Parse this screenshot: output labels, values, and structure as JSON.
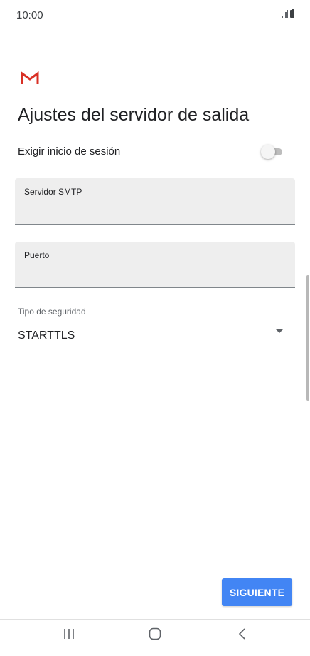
{
  "status_bar": {
    "time": "10:00",
    "signal_icon": "signal-icon",
    "battery_icon": "battery-icon"
  },
  "app": {
    "logo_icon": "gmail-logo-icon",
    "brand_color": "#d93025"
  },
  "page": {
    "title": "Ajustes del servidor de salida"
  },
  "require_signin": {
    "label": "Exigir inicio de sesión",
    "enabled": false
  },
  "fields": {
    "smtp_server": {
      "label": "Servidor SMTP",
      "value": ""
    },
    "port": {
      "label": "Puerto",
      "value": ""
    }
  },
  "security": {
    "label": "Tipo de seguridad",
    "selected": "STARTTLS"
  },
  "actions": {
    "next_label": "SIGUIENTE",
    "next_color": "#4285f4"
  },
  "nav_bar": {
    "recents_icon": "recents-icon",
    "home_icon": "home-icon",
    "back_icon": "back-icon"
  }
}
